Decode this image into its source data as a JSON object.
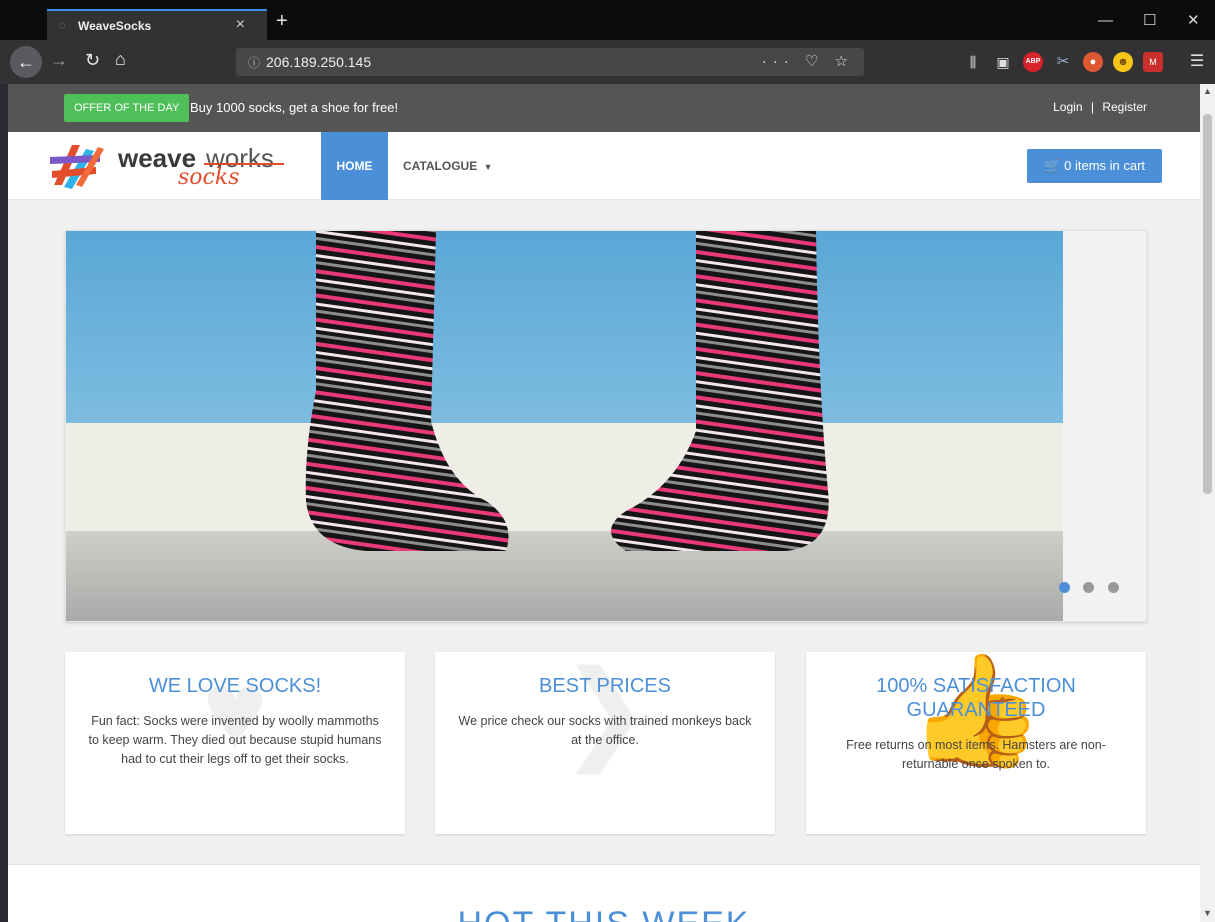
{
  "browser": {
    "tab_title": "WeaveSocks",
    "tab_close": "×",
    "new_tab": "+",
    "url": "206.189.250.145",
    "url_tools": "··· ♡ ☆",
    "window_minimize": "—",
    "window_maximize": "☐",
    "window_close": "✕"
  },
  "topbar": {
    "offer_label": "OFFER OF THE DAY",
    "offer_text": "Buy 1000 socks, get a shoe for free!",
    "login": "Login",
    "separator": "|",
    "register": "Register"
  },
  "header": {
    "logo_word1": "weave",
    "logo_word2": "works",
    "logo_word3": "socks",
    "nav_home": "HOME",
    "nav_catalogue": "CATALOGUE",
    "cart_label": "0 items in cart"
  },
  "carousel": {
    "slide_count": 3,
    "active_index": 0
  },
  "features": [
    {
      "title": "WE LOVE SOCKS!",
      "text": "Fun fact: Socks were invented by woolly mammoths to keep warm. They died out because stupid humans had to cut their legs off to get their socks."
    },
    {
      "title": "BEST PRICES",
      "text": "We price check our socks with trained monkeys back at the office."
    },
    {
      "title": "100% SATISFACTION GUARANTEED",
      "text": "Free returns on most items. Hamsters are non-returnable once spoken to."
    }
  ],
  "hot": {
    "title": "HOT THIS WEEK"
  },
  "colors": {
    "accent": "#4b8fd9",
    "offer_green": "#4fbf59",
    "topbar_gray": "#555555",
    "logo_red": "#e24d2c"
  }
}
